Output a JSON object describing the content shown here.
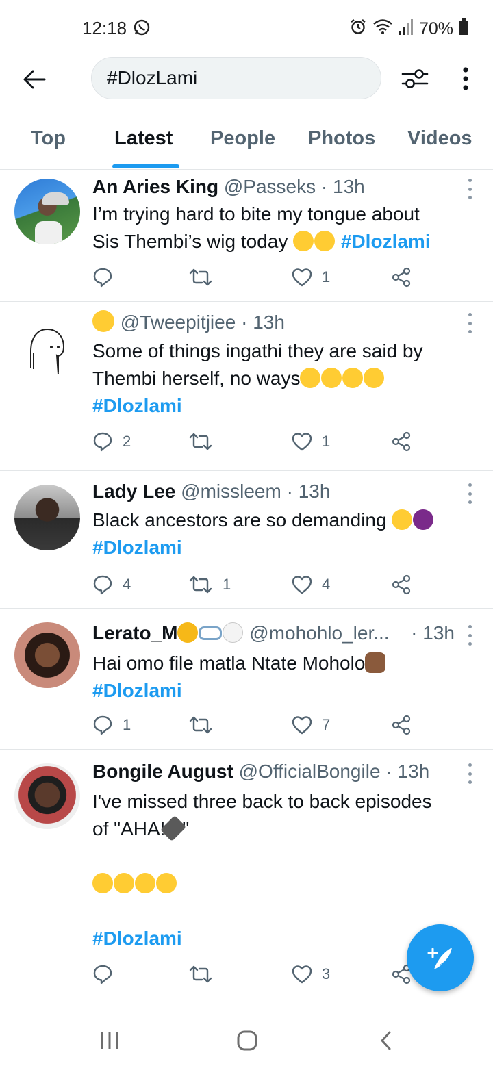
{
  "status_bar": {
    "time": "12:18",
    "battery": "70%"
  },
  "search": {
    "query": "#DlozLami"
  },
  "tabs": [
    {
      "label": "Top"
    },
    {
      "label": "Latest"
    },
    {
      "label": "People"
    },
    {
      "label": "Photos"
    },
    {
      "label": "Videos"
    }
  ],
  "active_tab": "Latest",
  "tweets": [
    {
      "name": "An Aries King",
      "handle": "@Passeks",
      "time": "13h",
      "text_lines": [
        "I’m trying hard to bite my tongue about",
        "Sis Thembi’s wig today"
      ],
      "emojis": [
        "grinning-sweat",
        "grinning-sweat"
      ],
      "hashtag": "#Dlozlami",
      "replies": "",
      "retweets": "",
      "likes": "1"
    },
    {
      "name": "",
      "name_emoji": "upside-down-face",
      "handle": "@Tweepitjiee",
      "time": "13h",
      "text_lines": [
        "Some of things ingathi they are said by",
        "Thembi herself, no ways"
      ],
      "emojis": [
        "rofl",
        "rofl",
        "rofl",
        "rofl"
      ],
      "hashtag": "#Dlozlami",
      "replies": "2",
      "retweets": "",
      "likes": "1"
    },
    {
      "name": "Lady Lee",
      "handle": "@missleem",
      "time": "13h",
      "text_lines": [
        "Black ancestors are so demanding"
      ],
      "emojis": [
        "loudly-crying",
        "woman-gesturing-no"
      ],
      "hashtag": "#Dlozlami",
      "replies": "4",
      "retweets": "1",
      "likes": "4"
    },
    {
      "name": "Lerato_M",
      "name_emojis": [
        "sunflower",
        "glasses",
        "thought-balloon"
      ],
      "handle": "@mohohlo_ler...",
      "time": "13h",
      "text_lines": [
        "Hai omo file matla Ntate Moholo"
      ],
      "emojis": [
        "flexed-biceps"
      ],
      "hashtag": "#Dlozlami",
      "replies": "1",
      "retweets": "",
      "likes": "7"
    },
    {
      "name": "Bongile August",
      "handle": "@OfficialBongile",
      "time": "13h",
      "text_lines": [
        "I've missed three back to back episodes",
        "of \"AHA!",
        "\""
      ],
      "emojis": [
        "pen",
        "loudly-crying",
        "loudly-crying",
        "loudly-crying",
        "loudly-crying"
      ],
      "hashtag": "#Dlozlami",
      "replies": "",
      "retweets": "",
      "likes": "3"
    }
  ],
  "colors": {
    "accent": "#1d9bf0",
    "text": "#0f1419",
    "secondary": "#536471"
  },
  "icons": [
    "back-arrow-icon",
    "filter-icon",
    "more-vert-icon",
    "reply-icon",
    "retweet-icon",
    "like-icon",
    "share-icon",
    "compose-icon",
    "recents-icon",
    "home-icon",
    "back-icon"
  ]
}
